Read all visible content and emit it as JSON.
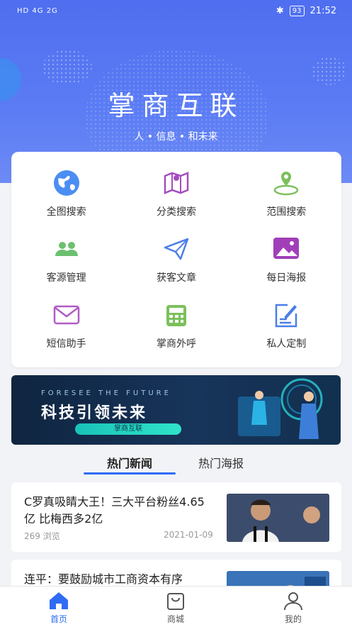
{
  "status_bar": {
    "left": "HD 4G 2G",
    "battery": "93",
    "time": "21:52"
  },
  "hero": {
    "brand": "掌商互联",
    "slogan": "人 • 信息 •  和未来"
  },
  "colors": {
    "primary": "#2f6cf5",
    "hero_bg": "#5b7cf4"
  },
  "menu": [
    {
      "label": "全图搜索",
      "icon": "globe-icon"
    },
    {
      "label": "分类搜索",
      "icon": "map-icon"
    },
    {
      "label": "范围搜索",
      "icon": "location-pin-icon"
    },
    {
      "label": "客源管理",
      "icon": "users-icon"
    },
    {
      "label": "获客文章",
      "icon": "paper-plane-icon"
    },
    {
      "label": "每日海报",
      "icon": "image-icon"
    },
    {
      "label": "短信助手",
      "icon": "envelope-icon"
    },
    {
      "label": "掌商外呼",
      "icon": "phone-icon"
    },
    {
      "label": "私人定制",
      "icon": "edit-icon"
    }
  ],
  "banner": {
    "en": "FORESEE THE FUTURE",
    "cn": "科技引领未来",
    "pill": "掌商互联"
  },
  "tabs": {
    "hot_news": "热门新闻",
    "hot_posters": "热门海报"
  },
  "news": [
    {
      "title": "C罗真吸睛大王！三大平台粉丝4.65亿 比梅西多2亿",
      "views": "269 浏览",
      "date": "2021-01-09"
    },
    {
      "title": "连平：要鼓励城市工商资本有序"
    }
  ],
  "tabbar": {
    "home": "首页",
    "mall": "商城",
    "mine": "我的"
  }
}
